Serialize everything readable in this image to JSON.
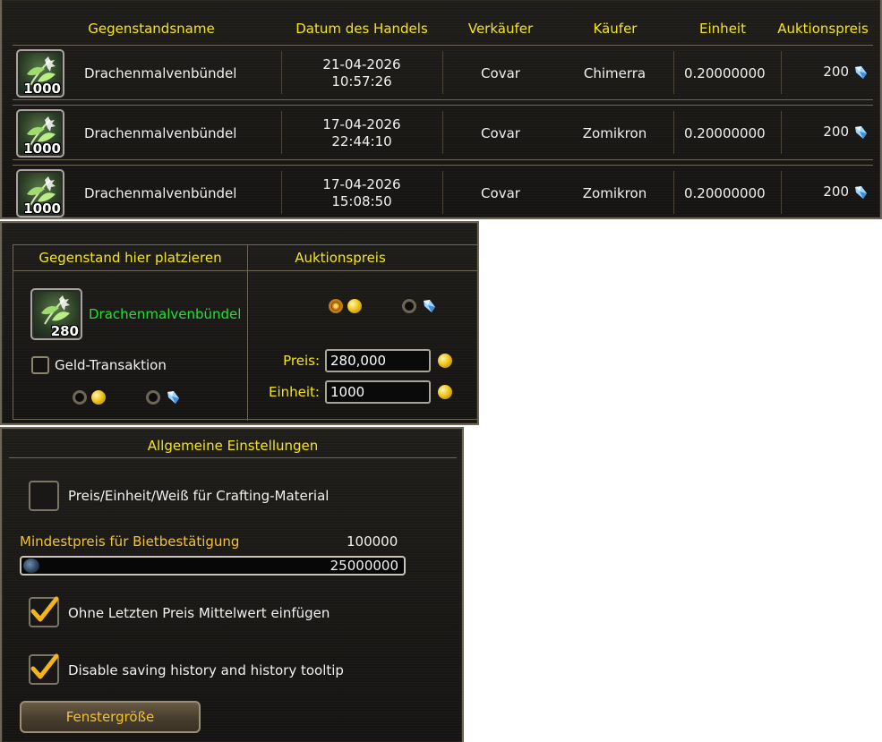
{
  "history": {
    "columns": {
      "item": "Gegenstandsname",
      "date": "Datum des Handels",
      "seller": "Verkäufer",
      "buyer": "Käufer",
      "unit": "Einheit",
      "price": "Auktionspreis"
    },
    "rows": [
      {
        "count": "1000",
        "name": "Drachenmalvenbündel",
        "date": "21-04-2026",
        "time": "10:57:26",
        "seller": "Covar",
        "buyer": "Chimerra",
        "unit": "0.20000000",
        "price": "200",
        "currency_icon": "crystal-icon"
      },
      {
        "count": "1000",
        "name": "Drachenmalvenbündel",
        "date": "17-04-2026",
        "time": "22:44:10",
        "seller": "Covar",
        "buyer": "Zomikron",
        "unit": "0.20000000",
        "price": "200",
        "currency_icon": "crystal-icon"
      },
      {
        "count": "1000",
        "name": "Drachenmalvenbündel",
        "date": "17-04-2026",
        "time": "15:08:50",
        "seller": "Covar",
        "buyer": "Zomikron",
        "unit": "0.20000000",
        "price": "200",
        "currency_icon": "crystal-icon"
      }
    ]
  },
  "auction": {
    "left_header": "Gegenstand hier platzieren",
    "right_header": "Auktionspreis",
    "item": {
      "count": "280",
      "name": "Drachenmalvenbündel"
    },
    "money_transaction_label": "Geld-Transaktion",
    "money_transaction_checked": false,
    "price_label": "Preis:",
    "price_value": "280,000",
    "unit_label": "Einheit:",
    "unit_value": "1000",
    "selected_currency": "gold-coin"
  },
  "settings": {
    "title": "Allgemeine Einstellungen",
    "option_crafting": {
      "label": "Preis/Einheit/Weiß für Crafting-Material",
      "checked": false
    },
    "min_price_label": "Mindestpreis für Bietbestätigung",
    "min_price_value": "100000",
    "slider_max": "25000000",
    "slider_level": 0,
    "option_average": {
      "label": "Ohne Letzten Preis Mittelwert einfügen",
      "checked": true
    },
    "option_history": {
      "label": "Disable saving history and history tooltip",
      "checked": true
    },
    "window_size_button": "Fenstergröße"
  },
  "colors": {
    "header_yellow": "#f3e51a",
    "item_green": "#23e135",
    "label_gold": "#f3c232",
    "panel_bg": "#1b1917",
    "frame": "#6d6656"
  }
}
